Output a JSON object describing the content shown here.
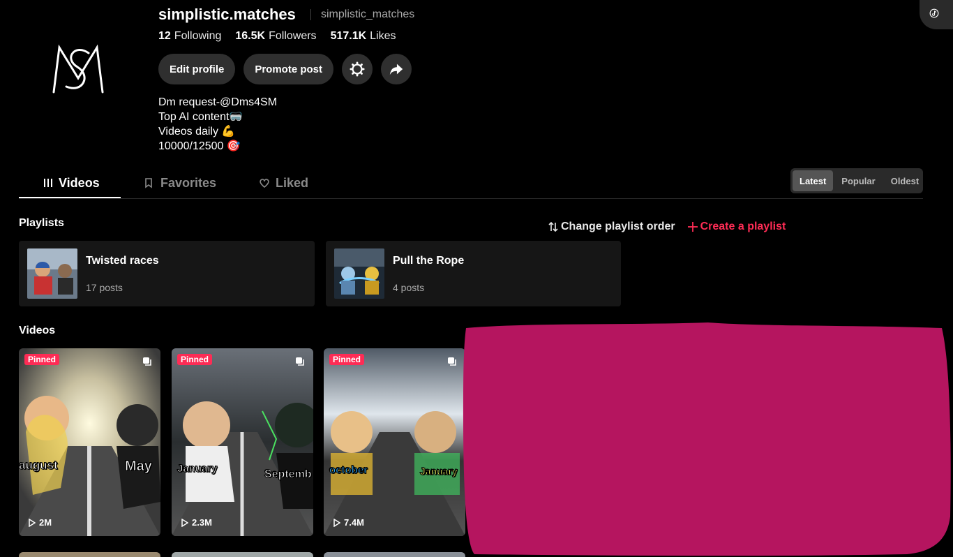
{
  "profile": {
    "username": "simplistic.matches",
    "handle": "simplistic_matches",
    "stats": [
      {
        "value": "12",
        "label": "Following"
      },
      {
        "value": "16.5K",
        "label": "Followers"
      },
      {
        "value": "517.1K",
        "label": "Likes"
      }
    ],
    "buttons": {
      "edit": "Edit profile",
      "promote": "Promote post"
    },
    "bio": [
      "Dm request-@Dms4SM",
      "Top AI content🥽",
      "Videos daily 💪",
      "10000/12500 🎯"
    ]
  },
  "tabs": [
    {
      "label": "Videos"
    },
    {
      "label": "Favorites"
    },
    {
      "label": "Liked"
    }
  ],
  "sort": [
    "Latest",
    "Popular",
    "Oldest"
  ],
  "playlists_section": {
    "title": "Playlists",
    "order_label": "Change playlist order",
    "create_label": "Create a playlist",
    "items": [
      {
        "name": "Twisted races",
        "count": "17 posts"
      },
      {
        "name": "Pull the Rope",
        "count": "4 posts"
      }
    ]
  },
  "videos_section": {
    "title": "Videos",
    "pinned_label": "Pinned",
    "items": [
      {
        "views": "2M",
        "label_left": "august",
        "label_right": "May"
      },
      {
        "views": "2.3M",
        "label_left": "January",
        "label_right": "Septemb"
      },
      {
        "views": "7.4M",
        "label_left": "october",
        "label_right": "January"
      }
    ]
  },
  "colors": {
    "accent": "#fe2c55",
    "redaction": "#b5155f"
  }
}
